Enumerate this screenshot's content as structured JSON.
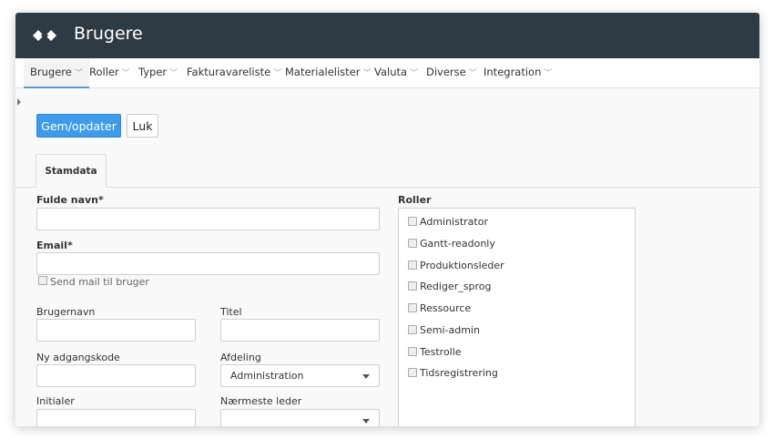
{
  "header": {
    "title": "Brugere",
    "logo_icon": "logo-icon"
  },
  "menu": [
    {
      "label": "Brugere",
      "active": true
    },
    {
      "label": "Roller"
    },
    {
      "label": "Typer"
    },
    {
      "label": "Fakturavareliste"
    },
    {
      "label": "Materialelister"
    },
    {
      "label": "Valuta"
    },
    {
      "label": "Diverse"
    },
    {
      "label": "Integration"
    }
  ],
  "actions": {
    "save_label": "Gem/opdater",
    "close_label": "Luk"
  },
  "tabs": [
    {
      "label": "Stamdata"
    }
  ],
  "form": {
    "full_name_label": "Fulde navn*",
    "full_name_value": "",
    "email_label": "Email*",
    "email_value": "",
    "send_mail_label": "Send mail til bruger",
    "username_label": "Brugernavn",
    "title_label": "Titel",
    "new_password_label": "Ny adgangskode",
    "department_label": "Afdeling",
    "department_value": "Administration",
    "initials_label": "Initialer",
    "manager_label": "Nærmeste leder",
    "manager_value": ""
  },
  "roles": {
    "label": "Roller",
    "items": [
      "Administrator",
      "Gantt-readonly",
      "Produktionsleder",
      "Rediger_sprog",
      "Ressource",
      "Semi-admin",
      "Testrolle",
      "Tidsregistrering"
    ]
  },
  "colors": {
    "topbar": "#2e3b45",
    "primary": "#3d9be9",
    "active_tab": "#5b9bd5"
  }
}
